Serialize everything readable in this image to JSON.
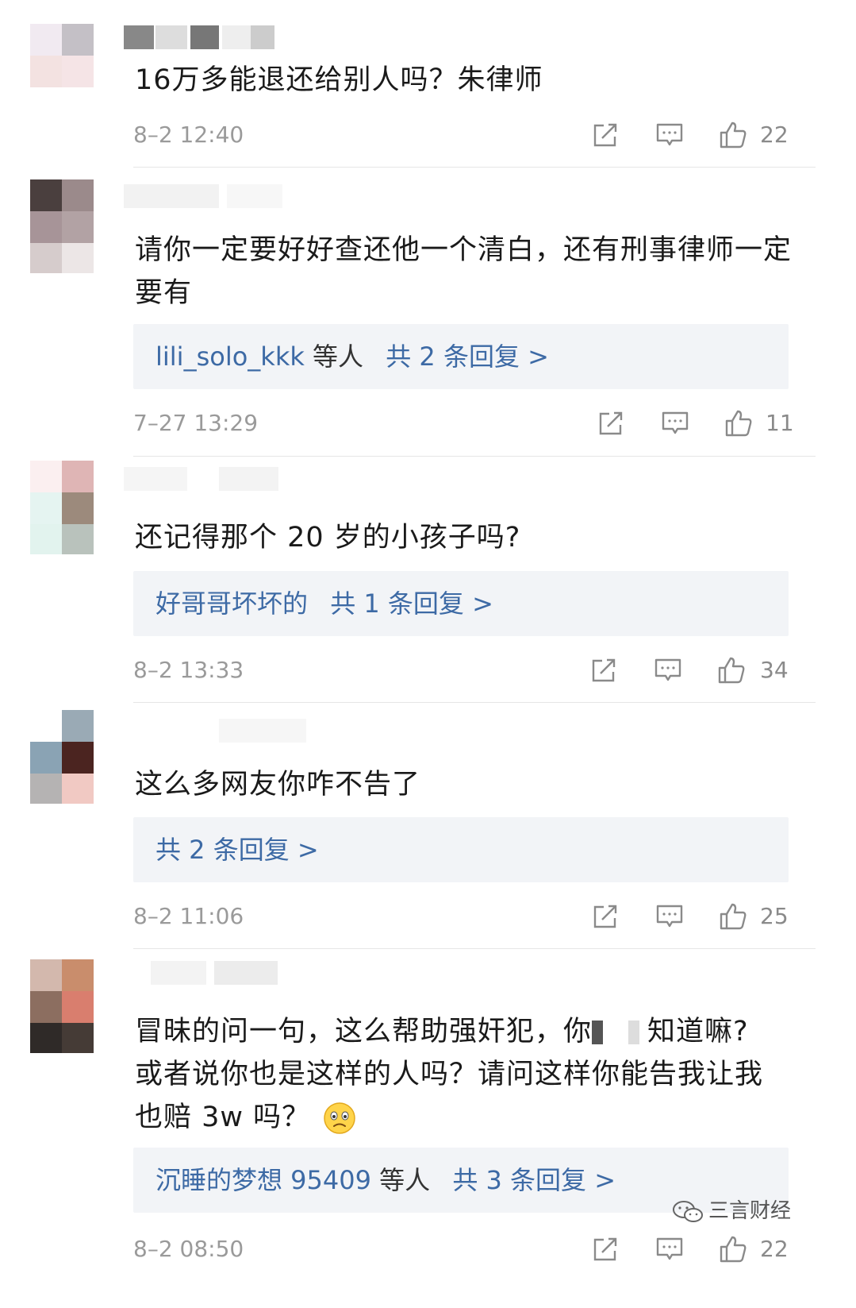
{
  "comments": [
    {
      "text": "16万多能退还给别人吗？朱律师",
      "time": "8–2 12:40",
      "likes": "22",
      "reply": null
    },
    {
      "text": "请你一定要好好查还他一个清白，还有刑事律师一定要有",
      "time": "7–27 13:29",
      "likes": "11",
      "reply": {
        "who": "lili_solo_kkk",
        "etc": "等人",
        "count": "共 2 条回复 >"
      }
    },
    {
      "text": "还记得那个 20 岁的小孩子吗?",
      "time": "8–2 13:33",
      "likes": "34",
      "reply": {
        "who": "好哥哥坏坏的",
        "etc": "",
        "count": "共 1 条回复 >"
      }
    },
    {
      "text": "这么多网友你咋不告了",
      "time": "8–2 11:06",
      "likes": "25",
      "reply": {
        "who": "",
        "etc": "",
        "count": "共 2 条回复 >"
      }
    },
    {
      "text_line1a": "冒昧的问一句，这么帮助强奸犯，你",
      "text_line1b": "知道嘛?",
      "text_line2": "或者说你也是这样的人吗？请问这样你能告我让我",
      "text_line3": "也赔 3w 吗？",
      "time": "8–2 08:50",
      "likes": "22",
      "reply": {
        "who": "沉睡的梦想 95409",
        "etc": "等人",
        "count": "共 3 条回复 >"
      }
    }
  ],
  "watermark": {
    "label": "三言财经"
  },
  "icons": {
    "share": "share-icon",
    "comment": "comment-icon",
    "like": "thumbs-up-icon"
  },
  "colors": {
    "link": "#3d6aa5",
    "meta": "#9a9a9a",
    "reply_bg": "#f2f4f7"
  }
}
